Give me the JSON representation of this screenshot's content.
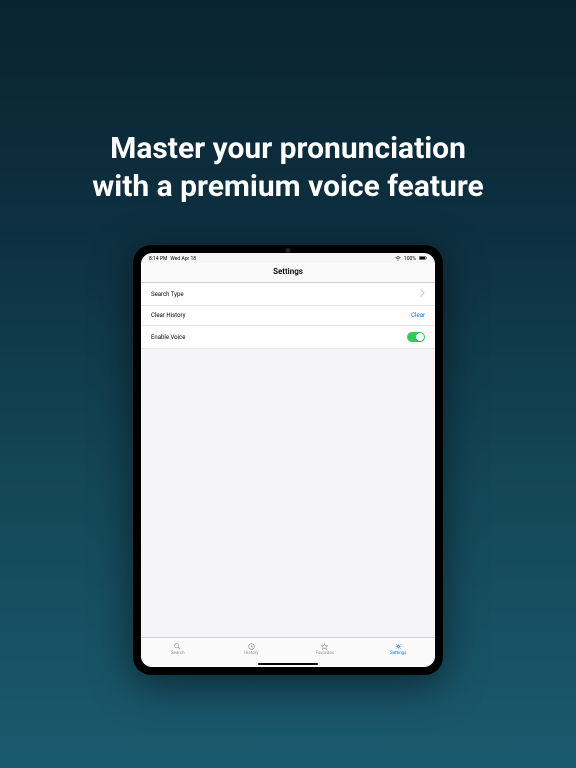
{
  "promo": {
    "headline_line1": "Master your pronunciation",
    "headline_line2": "with a premium voice feature"
  },
  "status": {
    "time": "8:14 PM",
    "date": "Wed Apr 18",
    "wifi": "●",
    "battery": "100%"
  },
  "nav": {
    "title": "Settings"
  },
  "rows": {
    "search_type": {
      "label": "Search Type"
    },
    "clear_history": {
      "label": "Clear History",
      "action": "Clear"
    },
    "enable_voice": {
      "label": "Enable Voice",
      "value": true
    }
  },
  "tabs": {
    "search": "Search",
    "history": "History",
    "favorites": "Favorites",
    "settings": "Settings"
  }
}
